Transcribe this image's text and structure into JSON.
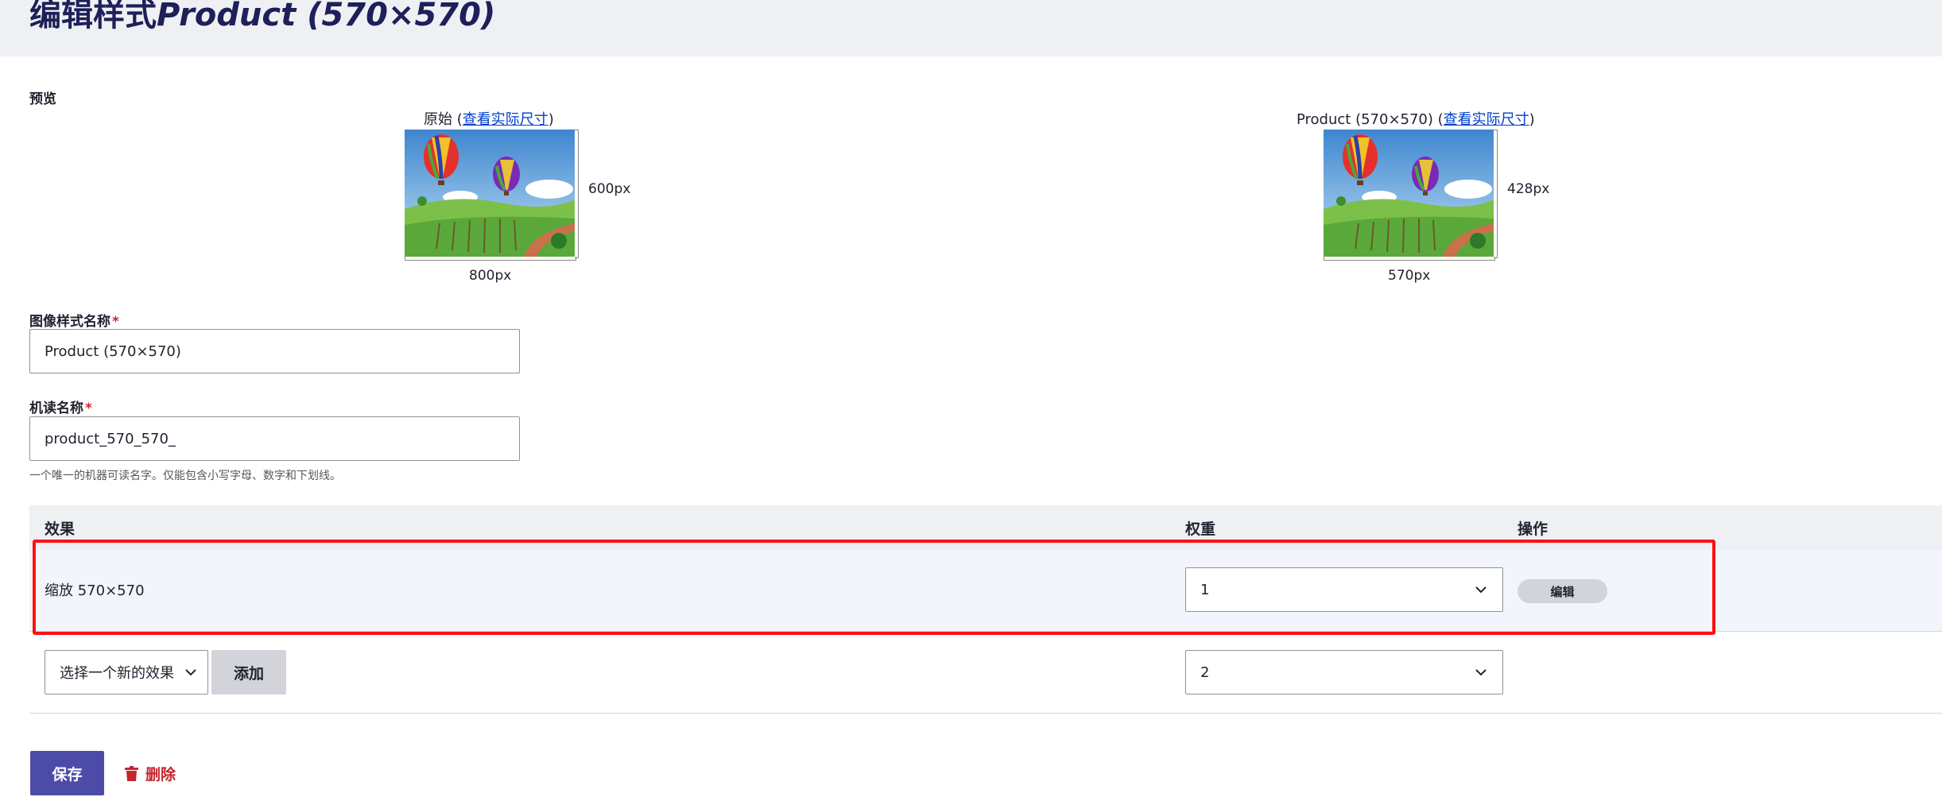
{
  "page": {
    "title_prefix": "编辑样式",
    "title_italic": "Product (570×570)"
  },
  "preview": {
    "label": "预览",
    "original": {
      "caption": "原始",
      "link_text": "查看实际尺寸",
      "height_label": "600px",
      "width_label": "800px"
    },
    "derivative": {
      "caption": "Product (570×570)",
      "link_text": "查看实际尺寸",
      "height_label": "428px",
      "width_label": "570px"
    }
  },
  "form": {
    "style_name": {
      "label": "图像样式名称",
      "required_mark": "*",
      "value": "Product (570×570)"
    },
    "machine_name": {
      "label": "机读名称",
      "required_mark": "*",
      "value": "product_570_570_",
      "help": "一个唯一的机器可读名字。仅能包含小写字母、数字和下划线。"
    }
  },
  "effects_table": {
    "headers": {
      "effect": "效果",
      "weight": "权重",
      "operations": "操作"
    },
    "rows": [
      {
        "effect": "缩放 570×570",
        "weight": "1",
        "operation_label": "编辑"
      }
    ],
    "new_effect": {
      "select_placeholder": "选择一个新的效果",
      "add_label": "添加",
      "weight": "2"
    }
  },
  "actions": {
    "save_label": "保存",
    "delete_label": "删除"
  },
  "colors": {
    "title": "#1e2059",
    "link": "#003ecc",
    "primary_button": "#4c4ca8",
    "danger": "#c4262e",
    "highlight_border": "#ff1111"
  },
  "icons": {
    "chevron": "chevron-down-icon",
    "trash": "trash-icon"
  }
}
